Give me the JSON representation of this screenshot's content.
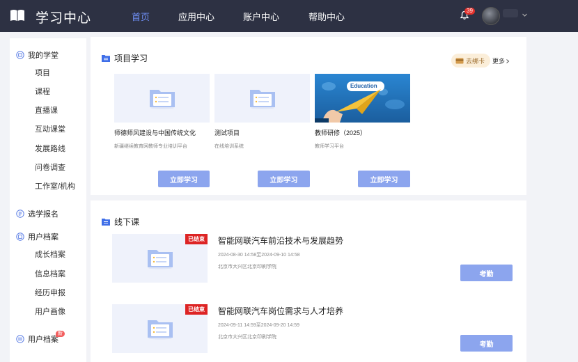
{
  "header": {
    "title": "学习中心",
    "nav": [
      "首页",
      "应用中心",
      "账户中心",
      "帮助中心"
    ],
    "notification_count": "39"
  },
  "sidebar": {
    "groups": [
      {
        "label": "我的学堂",
        "items": [
          "项目",
          "课程",
          "直播课",
          "互动课堂",
          "发展路线",
          "问卷调查",
          "工作室/机构"
        ]
      },
      {
        "label": "选学报名",
        "items": []
      },
      {
        "label": "用户档案",
        "items": [
          "成长档案",
          "信息档案",
          "经历申报",
          "用户画像"
        ]
      },
      {
        "label": "用户档案",
        "items": [],
        "badge": "新"
      }
    ]
  },
  "project_section": {
    "title": "项目学习",
    "bind_card_label": "去绑卡",
    "more_label": "更多",
    "cards": [
      {
        "name": "师德师风建设与中国传统文化",
        "sub": "新疆继续教育网教师专业培训平台",
        "button": "立即学习",
        "image": "folder-placeholder"
      },
      {
        "name": "测试项目",
        "sub": "在线培训系统",
        "button": "立即学习",
        "image": "folder-placeholder"
      },
      {
        "name": "教师研修（2025）",
        "sub": "教师学习平台",
        "button": "立即学习",
        "image": "education-photo",
        "image_text": "Education"
      }
    ]
  },
  "offline_section": {
    "title": "线下课",
    "courses": [
      {
        "title": "智能网联汽车前沿技术与发展趋势",
        "time": "2024-08-30 14:58至2024-09-10 14:58",
        "location": "北京市大兴区北京印刷学院",
        "status": "已结束",
        "button": "考勤"
      },
      {
        "title": "智能网联汽车岗位需求与人才培养",
        "time": "2024-09-11 14:59至2024-09-20 14:59",
        "location": "北京市大兴区北京印刷学院",
        "status": "已结束",
        "button": "考勤"
      }
    ]
  },
  "colors": {
    "header_bg": "#2d3143",
    "nav_active": "#6f8ff5",
    "button": "#8ca5ee",
    "ended": "#dd2424"
  }
}
